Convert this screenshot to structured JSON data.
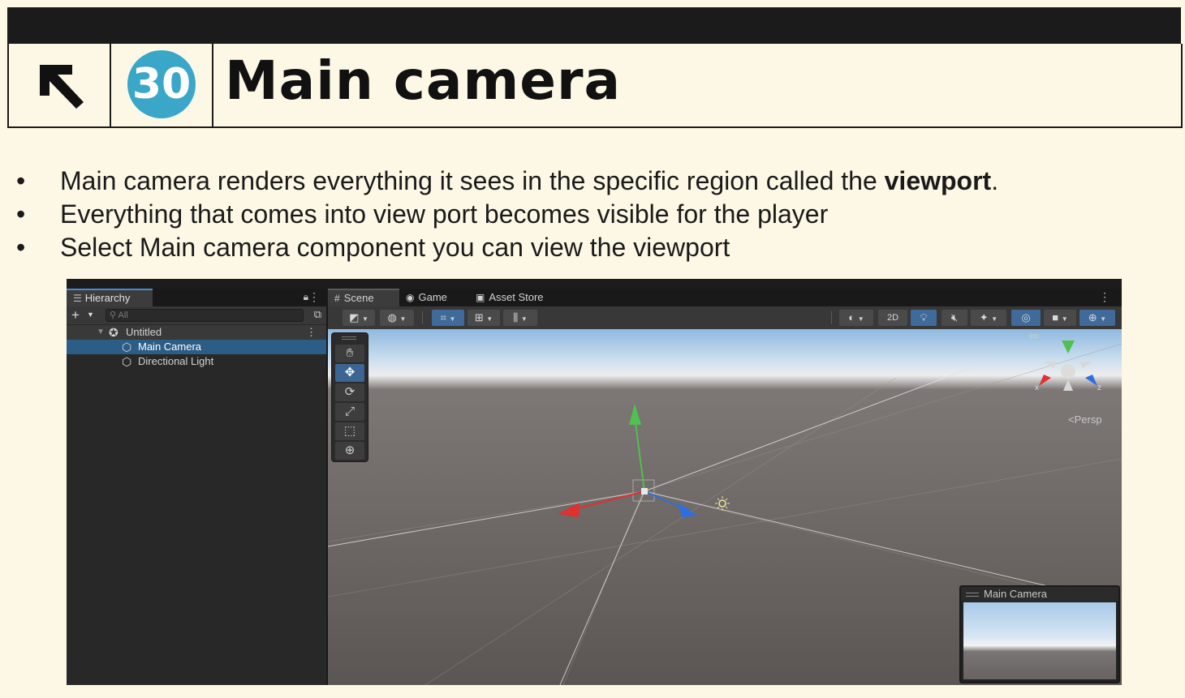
{
  "slide": {
    "number": "30",
    "title": "Main camera",
    "back_icon": "arrow-up-left-icon",
    "bullets": [
      {
        "text": "Main camera renders everything it sees in the specific region called the ",
        "bold": "viewport",
        "after": "."
      },
      {
        "text": "Everything that comes into view port becomes visible for the player",
        "bold": "",
        "after": ""
      },
      {
        "text": "Select Main camera component you can view the viewport",
        "bold": "",
        "after": ""
      }
    ]
  },
  "editor": {
    "hierarchy": {
      "tab_label": "Hierarchy",
      "search_placeholder": "All",
      "scene_name": "Untitled",
      "items": [
        "Main Camera",
        "Directional Light"
      ],
      "selected": "Main Camera"
    },
    "scene": {
      "tabs": [
        "Scene",
        "Game",
        "Asset Store"
      ],
      "active_tab": "Scene",
      "toolbar_2d": "2D",
      "tools": [
        "hand-tool",
        "move-tool",
        "rotate-tool",
        "scale-tool",
        "rect-tool",
        "transform-tool"
      ],
      "active_tool": "move-tool",
      "gizmo": {
        "x": "x",
        "z": "z",
        "projection": "Persp"
      },
      "camera_preview_title": "Main Camera"
    },
    "colors": {
      "selection": "#2c5d87",
      "axis_x": "#e03030",
      "axis_y": "#4fc14f",
      "axis_z": "#2d6fe0",
      "badge": "#3aa7c9"
    }
  }
}
